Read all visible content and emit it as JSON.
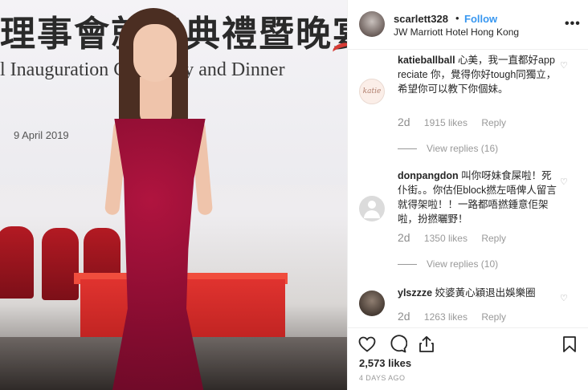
{
  "photo": {
    "banner_cjk": "理事會就職典禮暨晚宴",
    "banner_en": "l Inauguration Ceremony and Dinner",
    "banner_date": "9 April 2019"
  },
  "post": {
    "username": "scarlett328",
    "separator": "•",
    "follow_label": "Follow",
    "location": "JW Marriott Hotel Hong Kong",
    "more_label": "•••",
    "likes": "2,573 likes",
    "posted": "4 DAYS AGO"
  },
  "comments": [
    {
      "user": "katieballball",
      "text": "心美，我一直都好appreciate 你，覺得你好tough同獨立，希望你可以教下你個妹。",
      "age": "2d",
      "likes": "1915 likes",
      "reply": "Reply",
      "view_replies": "View replies (16)",
      "avatar_text": "katie"
    },
    {
      "user": "donpangdon",
      "text": "叫你呀妹食屎啦！死仆街。。你估佢block撚左唔俾人留言就得架啦！！一路都唔撚鍾意佢架啦，扮撚曬野！",
      "age": "2d",
      "likes": "1350 likes",
      "reply": "Reply",
      "view_replies": "View replies (10)"
    },
    {
      "user": "ylszzze",
      "text": "姣婆黃心穎退出娛樂圈",
      "age": "2d",
      "likes": "1263 likes",
      "reply": "Reply"
    }
  ],
  "icons": {
    "like": "heart-icon",
    "comment": "comment-bubble-icon",
    "share": "share-icon",
    "save": "bookmark-icon",
    "comment_like": "small-heart-icon"
  },
  "colors": {
    "follow": "#3897f0",
    "muted": "#999999",
    "text": "#262626"
  }
}
